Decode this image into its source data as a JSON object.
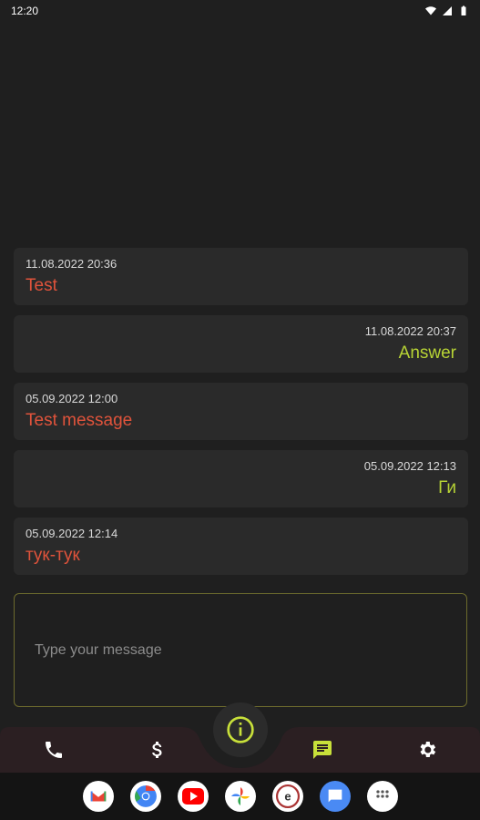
{
  "status": {
    "time": "12:20"
  },
  "messages": [
    {
      "direction": "in",
      "time": "11.08.2022 20:36",
      "text": "Test"
    },
    {
      "direction": "out",
      "time": "11.08.2022 20:37",
      "text": "Answer"
    },
    {
      "direction": "in",
      "time": "05.09.2022 12:00",
      "text": "Test message"
    },
    {
      "direction": "out",
      "time": "05.09.2022 12:13",
      "text": "Ги"
    },
    {
      "direction": "in",
      "time": "05.09.2022 12:14",
      "text": "тук-тук"
    }
  ],
  "compose": {
    "placeholder": "Type your message"
  },
  "nav": [
    {
      "icon": "phone-icon"
    },
    {
      "icon": "dollar-icon"
    },
    {
      "icon": "info-icon"
    },
    {
      "icon": "chat-icon"
    },
    {
      "icon": "settings-icon"
    }
  ],
  "colors": {
    "incoming": "#e0533b",
    "outgoing": "#b7d335",
    "accent": "#c8e03a",
    "nav_bg": "#2b1f22"
  },
  "dock": [
    {
      "icon": "gmail-icon"
    },
    {
      "icon": "chrome-icon"
    },
    {
      "icon": "youtube-icon"
    },
    {
      "icon": "photos-icon"
    },
    {
      "icon": "edge-like-icon"
    },
    {
      "icon": "messages-icon"
    },
    {
      "icon": "app-drawer-icon"
    }
  ]
}
